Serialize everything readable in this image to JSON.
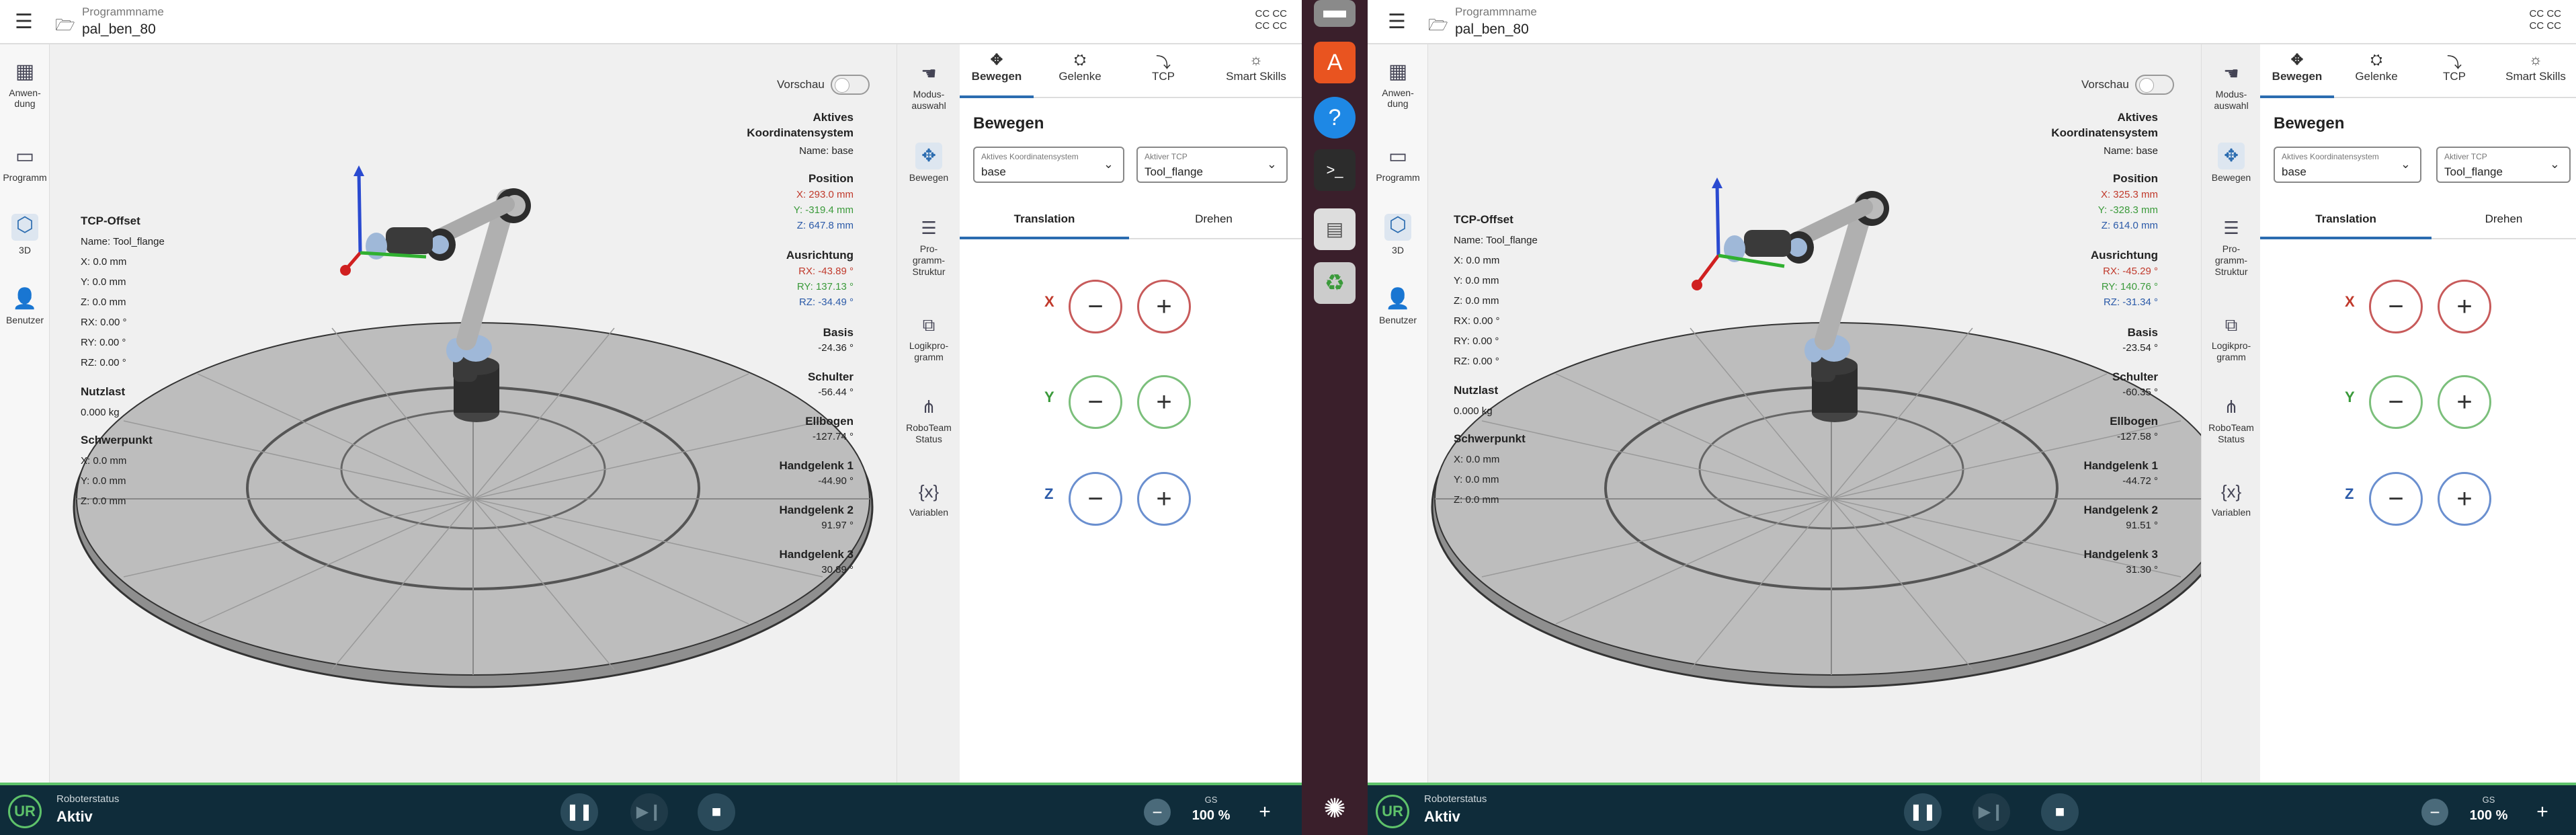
{
  "left": {
    "header": {
      "program_label": "Programmname",
      "program_name": "pal_ben_80",
      "cc1": "CC CC",
      "cc2": "CC CC"
    },
    "nav": [
      {
        "label": "Anwen-\ndung"
      },
      {
        "label": "Programm"
      },
      {
        "label": "3D"
      },
      {
        "label": "Benutzer"
      }
    ],
    "vorschau": "Vorschau",
    "tcp": {
      "title": "TCP-Offset",
      "name": "Name: Tool_flange",
      "x": "X: 0.0 mm",
      "y": "Y: 0.0 mm",
      "z": "Z: 0.0 mm",
      "rx": "RX: 0.00 °",
      "ry": "RY: 0.00 °",
      "rz": "RZ: 0.00 °"
    },
    "payload": {
      "title": "Nutzlast",
      "value": "0.000 kg"
    },
    "cog": {
      "title": "Schwerpunkt",
      "x": "X: 0.0 mm",
      "y": "Y: 0.0 mm",
      "z": "Z: 0.0 mm"
    },
    "coords": {
      "t1": "Aktives",
      "t2": "Koordinatensystem",
      "name": "Name: base"
    },
    "pos": {
      "title": "Position",
      "x": "X: 293.0 mm",
      "y": "Y: -319.4 mm",
      "z": "Z: 647.8 mm"
    },
    "ori": {
      "title": "Ausrichtung",
      "rx": "RX: -43.89 °",
      "ry": "RY: 137.13 °",
      "rz": "RZ: -34.49 °"
    },
    "joints": [
      {
        "name": "Basis",
        "value": "-24.36 °"
      },
      {
        "name": "Schulter",
        "value": "-56.44 °"
      },
      {
        "name": "Ellbogen",
        "value": "-127.74 °"
      },
      {
        "name": "Handgelenk 1",
        "value": "-44.90 °"
      },
      {
        "name": "Handgelenk 2",
        "value": "91.97 °"
      },
      {
        "name": "Handgelenk 3",
        "value": "30.89 °"
      }
    ],
    "speed": "100 %"
  },
  "right": {
    "header": {
      "program_label": "Programmname",
      "program_name": "pal_ben_80",
      "cc1": "CC CC",
      "cc2": "CC CC"
    },
    "nav": [
      {
        "label": "Anwen-\ndung"
      },
      {
        "label": "Programm"
      },
      {
        "label": "3D"
      },
      {
        "label": "Benutzer"
      }
    ],
    "vorschau": "Vorschau",
    "tcp": {
      "title": "TCP-Offset",
      "name": "Name: Tool_flange",
      "x": "X: 0.0 mm",
      "y": "Y: 0.0 mm",
      "z": "Z: 0.0 mm",
      "rx": "RX: 0.00 °",
      "ry": "RY: 0.00 °",
      "rz": "RZ: 0.00 °"
    },
    "payload": {
      "title": "Nutzlast",
      "value": "0.000 kg"
    },
    "cog": {
      "title": "Schwerpunkt",
      "x": "X: 0.0 mm",
      "y": "Y: 0.0 mm",
      "z": "Z: 0.0 mm"
    },
    "coords": {
      "t1": "Aktives",
      "t2": "Koordinatensystem",
      "name": "Name: base"
    },
    "pos": {
      "title": "Position",
      "x": "X: 325.3 mm",
      "y": "Y: -328.3 mm",
      "z": "Z: 614.0 mm"
    },
    "ori": {
      "title": "Ausrichtung",
      "rx": "RX: -45.29 °",
      "ry": "RY: 140.76 °",
      "rz": "RZ: -31.34 °"
    },
    "joints": [
      {
        "name": "Basis",
        "value": "-23.54 °"
      },
      {
        "name": "Schulter",
        "value": "-60.35 °"
      },
      {
        "name": "Ellbogen",
        "value": "-127.58 °"
      },
      {
        "name": "Handgelenk 1",
        "value": "-44.72 °"
      },
      {
        "name": "Handgelenk 2",
        "value": "91.51 °"
      },
      {
        "name": "Handgelenk 3",
        "value": "31.30 °"
      }
    ],
    "speed": "100 %"
  },
  "sidetabs": [
    {
      "label": "Modus-\nauswahl"
    },
    {
      "label": "Bewegen"
    },
    {
      "label": "Pro-\ngramm-\nStruktur"
    },
    {
      "label": "Logikpro-\ngramm"
    },
    {
      "label": "RoboTeam\nStatus"
    },
    {
      "label": "Variablen"
    }
  ],
  "move": {
    "tabs": [
      "Bewegen",
      "Gelenke",
      "TCP",
      "Smart Skills"
    ],
    "title": "Bewegen",
    "coord_label": "Aktives Koordinatensystem",
    "coord_value": "base",
    "tcp_label": "Aktiver TCP",
    "tcp_value": "Tool_flange",
    "sub_translation": "Translation",
    "sub_rotate": "Drehen",
    "axes": [
      "X",
      "Y",
      "Z"
    ],
    "minus": "−",
    "plus": "+"
  },
  "status": {
    "label": "Roboterstatus",
    "value": "Aktiv",
    "gs": "GS",
    "logo": "UR"
  }
}
